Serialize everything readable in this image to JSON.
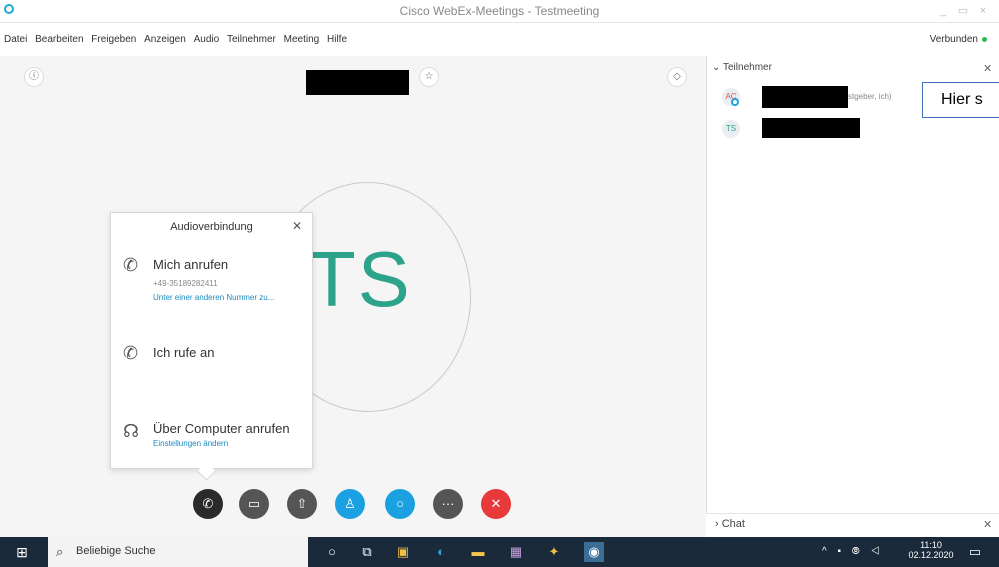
{
  "window": {
    "title": "Cisco WebEx-Meetings - Testmeeting",
    "controls": [
      "_",
      "▭",
      "×"
    ]
  },
  "menu": [
    "Datei",
    "Bearbeiten",
    "Freigeben",
    "Anzeigen",
    "Audio",
    "Teilnehmer",
    "Meeting",
    "Hilfe"
  ],
  "status": "Verbunden",
  "stage": {
    "avatar_initials": "TS"
  },
  "audio_popup": {
    "title": "Audioverbindung",
    "call_me": {
      "label": "Mich anrufen",
      "number": "+49-35189282411",
      "link": "Unter einer anderen Nummer zu..."
    },
    "i_call": {
      "label": "Ich rufe an"
    },
    "computer": {
      "label": "Über Computer anrufen",
      "link": "Einstellungen ändern"
    }
  },
  "controls": {
    "colors": {
      "audio": "#2a2a2a",
      "video": "#555555",
      "share": "#555555",
      "participants": "#1ba1e2",
      "chat": "#1ba1e2",
      "more": "#555555",
      "end": "#e8393b"
    },
    "more_label": "···"
  },
  "panel": {
    "header": "Teilnehmer",
    "participants": [
      {
        "initials": "AC",
        "role_suffix": "stgeber, ich)"
      },
      {
        "initials": "TS",
        "role_suffix": ""
      }
    ],
    "hint_text": "Hier s",
    "chat_label": "Chat"
  },
  "taskbar": {
    "search_placeholder": "Beliebige Suche",
    "time": "11:10",
    "date": "02.12.2020"
  }
}
